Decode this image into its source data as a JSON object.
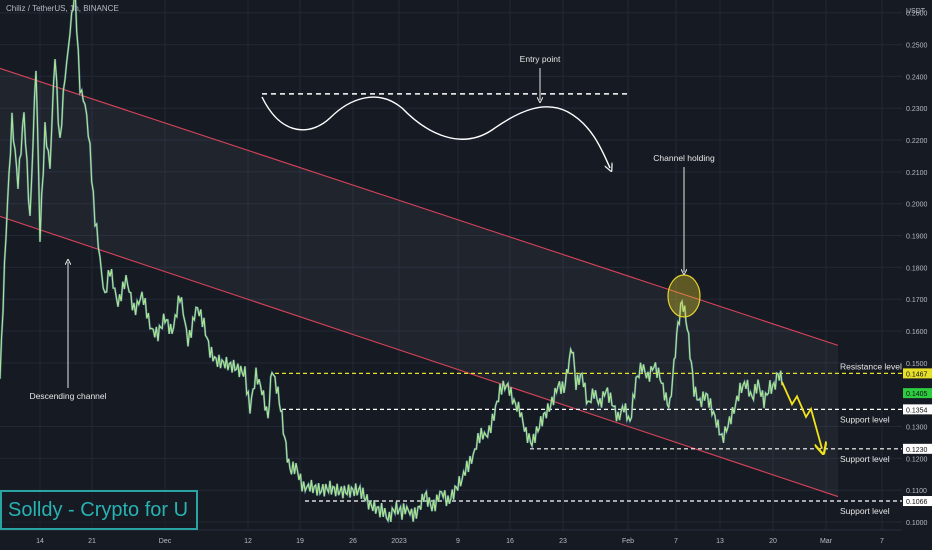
{
  "header": {
    "symbol": "Chiliz / TetherUS, 1h, BINANCE"
  },
  "chart_data": {
    "type": "line",
    "quote_currency": "USDT",
    "x_ticks": [
      "14",
      "21",
      "Dec",
      "12",
      "19",
      "26",
      "2023",
      "9",
      "16",
      "23",
      "Feb",
      "7",
      "13",
      "20",
      "Mar",
      "7"
    ],
    "y_ticks": [
      "0.2600",
      "0.2500",
      "0.2400",
      "0.2300",
      "0.2200",
      "0.2100",
      "0.2000",
      "0.1900",
      "0.1800",
      "0.1700",
      "0.1600",
      "0.1500",
      "0.1300",
      "0.1200",
      "0.1100",
      "0.1000"
    ],
    "ylim": [
      0.0975,
      0.264
    ],
    "price_points": [
      [
        0,
        0.145
      ],
      [
        6,
        0.19
      ],
      [
        12,
        0.225
      ],
      [
        18,
        0.205
      ],
      [
        24,
        0.228
      ],
      [
        30,
        0.195
      ],
      [
        36,
        0.245
      ],
      [
        40,
        0.189
      ],
      [
        45,
        0.225
      ],
      [
        50,
        0.21
      ],
      [
        55,
        0.248
      ],
      [
        60,
        0.218
      ],
      [
        65,
        0.24
      ],
      [
        70,
        0.255
      ],
      [
        75,
        0.265
      ],
      [
        80,
        0.238
      ],
      [
        85,
        0.23
      ],
      [
        90,
        0.218
      ],
      [
        95,
        0.195
      ],
      [
        100,
        0.182
      ],
      [
        105,
        0.172
      ],
      [
        110,
        0.178
      ],
      [
        118,
        0.17
      ],
      [
        126,
        0.175
      ],
      [
        134,
        0.168
      ],
      [
        142,
        0.17
      ],
      [
        150,
        0.163
      ],
      [
        158,
        0.158
      ],
      [
        165,
        0.165
      ],
      [
        172,
        0.161
      ],
      [
        180,
        0.17
      ],
      [
        188,
        0.158
      ],
      [
        196,
        0.166
      ],
      [
        204,
        0.163
      ],
      [
        210,
        0.155
      ],
      [
        216,
        0.152
      ],
      [
        225,
        0.15
      ],
      [
        235,
        0.15
      ],
      [
        245,
        0.148
      ],
      [
        250,
        0.135
      ],
      [
        256,
        0.145
      ],
      [
        262,
        0.14
      ],
      [
        268,
        0.132
      ],
      [
        272,
        0.147
      ],
      [
        278,
        0.139
      ],
      [
        282,
        0.133
      ],
      [
        286,
        0.125
      ],
      [
        290,
        0.116
      ],
      [
        296,
        0.118
      ],
      [
        302,
        0.113
      ],
      [
        310,
        0.11
      ],
      [
        320,
        0.11
      ],
      [
        330,
        0.112
      ],
      [
        340,
        0.111
      ],
      [
        350,
        0.11
      ],
      [
        360,
        0.109
      ],
      [
        370,
        0.104
      ],
      [
        380,
        0.103
      ],
      [
        388,
        0.101
      ],
      [
        395,
        0.103
      ],
      [
        402,
        0.102
      ],
      [
        410,
        0.104
      ],
      [
        418,
        0.103
      ],
      [
        425,
        0.11
      ],
      [
        432,
        0.106
      ],
      [
        440,
        0.108
      ],
      [
        448,
        0.107
      ],
      [
        455,
        0.109
      ],
      [
        462,
        0.112
      ],
      [
        470,
        0.12
      ],
      [
        478,
        0.125
      ],
      [
        486,
        0.128
      ],
      [
        494,
        0.133
      ],
      [
        500,
        0.14
      ],
      [
        508,
        0.144
      ],
      [
        514,
        0.139
      ],
      [
        520,
        0.136
      ],
      [
        526,
        0.128
      ],
      [
        532,
        0.124
      ],
      [
        538,
        0.128
      ],
      [
        545,
        0.134
      ],
      [
        552,
        0.139
      ],
      [
        558,
        0.144
      ],
      [
        564,
        0.142
      ],
      [
        568,
        0.15
      ],
      [
        572,
        0.155
      ],
      [
        576,
        0.142
      ],
      [
        582,
        0.145
      ],
      [
        588,
        0.136
      ],
      [
        594,
        0.141
      ],
      [
        600,
        0.138
      ],
      [
        606,
        0.143
      ],
      [
        612,
        0.139
      ],
      [
        618,
        0.133
      ],
      [
        624,
        0.136
      ],
      [
        630,
        0.13
      ],
      [
        636,
        0.143
      ],
      [
        642,
        0.148
      ],
      [
        648,
        0.145
      ],
      [
        654,
        0.15
      ],
      [
        660,
        0.147
      ],
      [
        666,
        0.14
      ],
      [
        670,
        0.137
      ],
      [
        674,
        0.148
      ],
      [
        678,
        0.162
      ],
      [
        682,
        0.171
      ],
      [
        686,
        0.164
      ],
      [
        690,
        0.152
      ],
      [
        694,
        0.142
      ],
      [
        700,
        0.137
      ],
      [
        706,
        0.139
      ],
      [
        712,
        0.134
      ],
      [
        718,
        0.129
      ],
      [
        722,
        0.125
      ],
      [
        728,
        0.129
      ],
      [
        734,
        0.134
      ],
      [
        740,
        0.141
      ],
      [
        746,
        0.144
      ],
      [
        752,
        0.14
      ],
      [
        758,
        0.145
      ],
      [
        764,
        0.139
      ],
      [
        770,
        0.143
      ],
      [
        774,
        0.144
      ],
      [
        778,
        0.146
      ],
      [
        782,
        0.143
      ]
    ],
    "descending_channel": {
      "upper": [
        [
          0,
          0.2425
        ],
        [
          838,
          0.1555
        ]
      ],
      "lower": [
        [
          0,
          0.196
        ],
        [
          838,
          0.108
        ]
      ]
    },
    "levels": [
      {
        "label": "Resistance level",
        "price": 0.1467,
        "badge": "0.1467",
        "from_x": 275,
        "color": "#e6e02a",
        "badge_bg": "#e6e02a"
      },
      {
        "label": "Support level",
        "price": 0.1354,
        "badge": "0.1354",
        "from_x": 282,
        "color": "#ffffff",
        "badge_bg": "#ffffff"
      },
      {
        "label": "Support level",
        "price": 0.123,
        "badge": "0.1230",
        "from_x": 530,
        "color": "#ffffff",
        "badge_bg": "#ffffff"
      },
      {
        "label": "Support level",
        "price": 0.1066,
        "badge": "0.1066",
        "from_x": 305,
        "color": "#ffffff",
        "badge_bg": "#ffffff"
      }
    ],
    "current_price": {
      "price": 0.1405,
      "badge": "0.1405",
      "bg": "#2ecc40"
    },
    "entry_line": {
      "price": 0.2345,
      "from_x": 262,
      "to_x": 630
    },
    "annotations": [
      {
        "text": "Entry point",
        "kind": "arrow-down"
      },
      {
        "text": "Channel holding",
        "kind": "arrow-down"
      },
      {
        "text": "Descending channel",
        "kind": "arrow-up"
      }
    ],
    "highlight": {
      "x": 684,
      "price": 0.171
    },
    "projection": [
      [
        782,
        0.144
      ],
      [
        792,
        0.137
      ],
      [
        797,
        0.1395
      ],
      [
        806,
        0.133
      ],
      [
        811,
        0.1355
      ],
      [
        822,
        0.123
      ]
    ],
    "colors": {
      "price": "#a9e58a",
      "channel": "#d7435a",
      "resistance": "#e6e02a",
      "projection": "#f2e21a",
      "text": "#c8ccd4"
    }
  },
  "brand": {
    "label": "Solldy - Crypto for U"
  }
}
